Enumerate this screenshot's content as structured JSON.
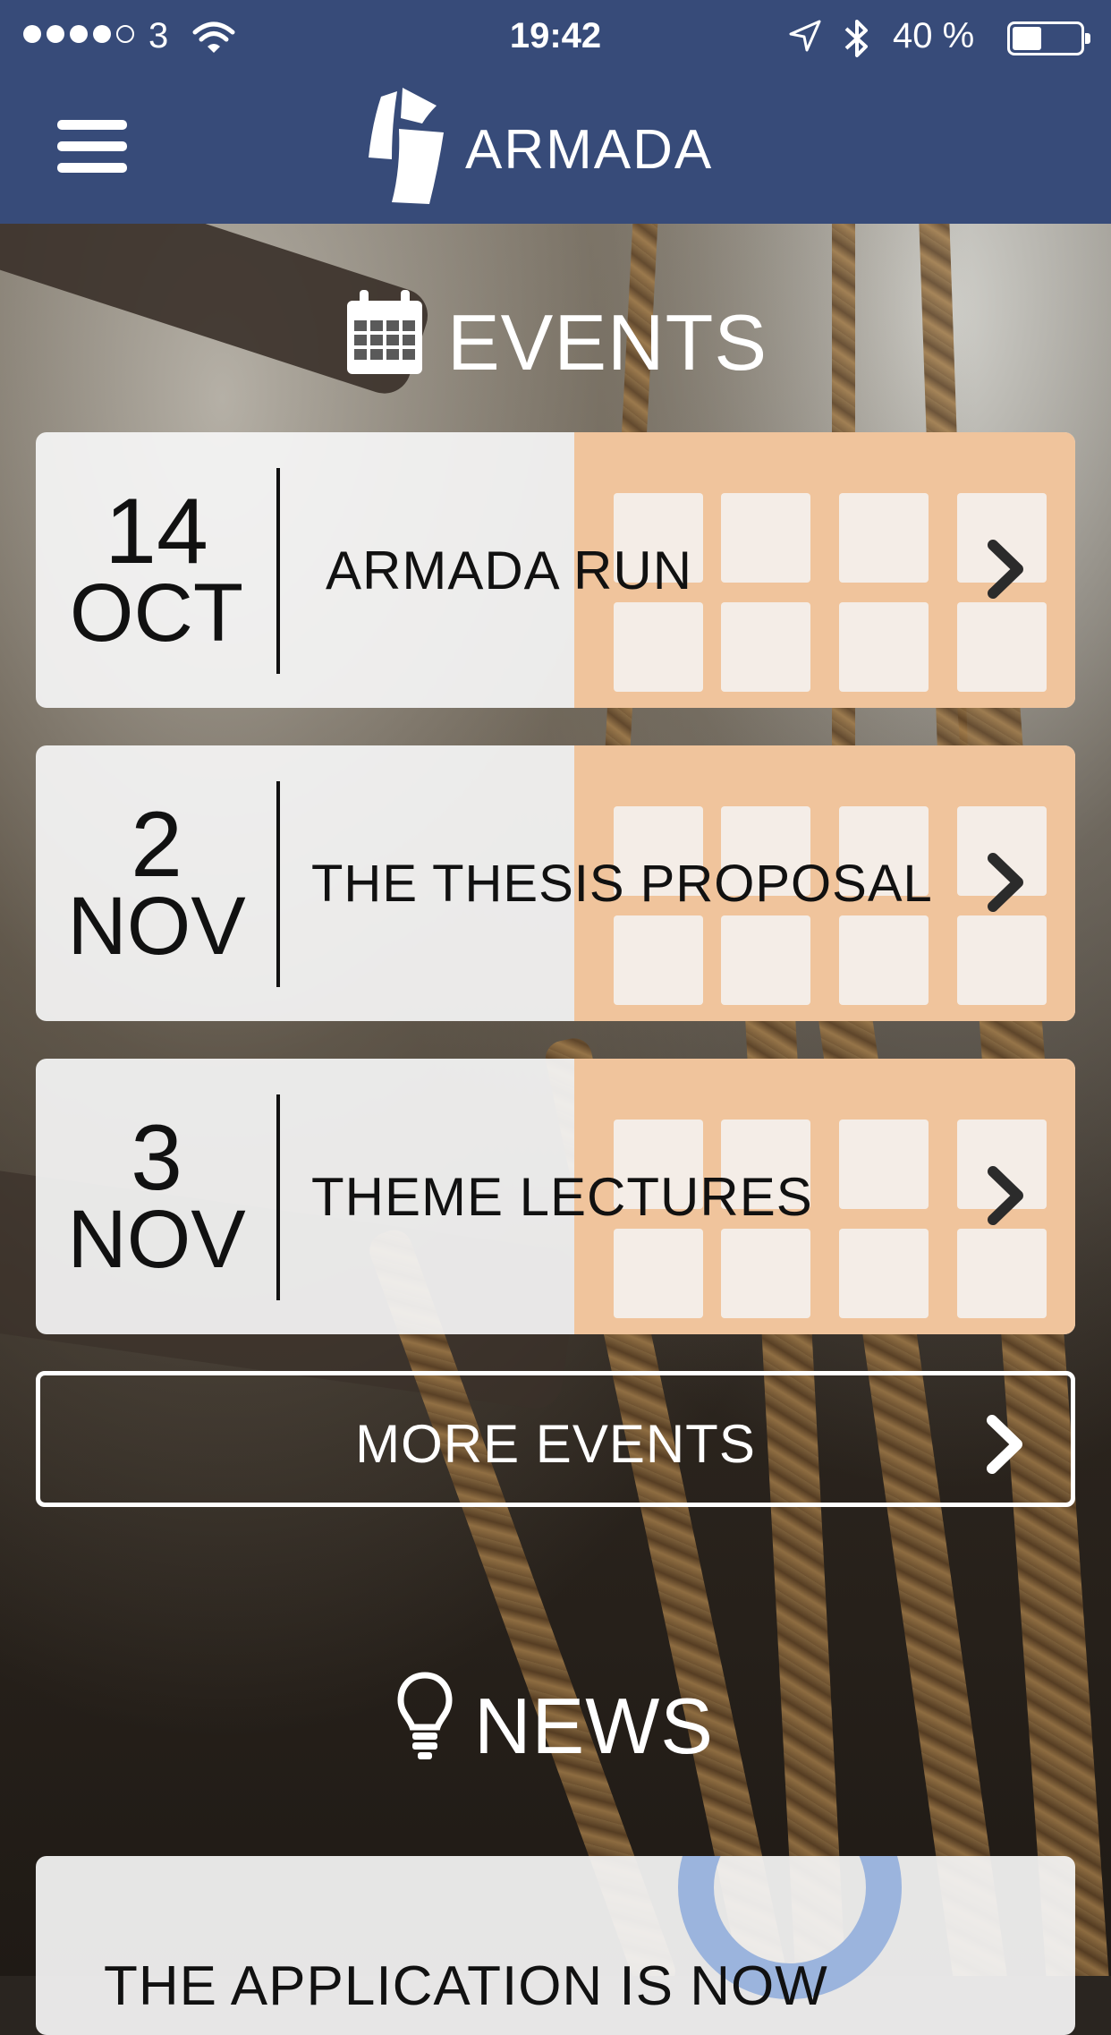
{
  "status_bar": {
    "carrier": "3",
    "time": "19:42",
    "battery": "40 %",
    "battery_level": 0.4
  },
  "header": {
    "brand": "ARMADA",
    "menu_icon": "hamburger-icon",
    "logo_icon": "ship-sail-logo"
  },
  "events": {
    "title": "EVENTS",
    "icon": "calendar-icon",
    "items": [
      {
        "day": "14",
        "month": "OCT",
        "title": "ARMADA RUN"
      },
      {
        "day": "2",
        "month": "NOV",
        "title": "THE THESIS PROPOSAL"
      },
      {
        "day": "3",
        "month": "NOV",
        "title": "THEME LECTURES"
      }
    ],
    "more_label": "MORE EVENTS"
  },
  "news": {
    "title": "NEWS",
    "icon": "lightbulb-icon",
    "items": [
      {
        "headline": "THE APPLICATION IS NOW"
      }
    ]
  },
  "colors": {
    "header_bg": "#374b79",
    "card_bg": "#f5f5f5",
    "calendar_accent": "#f0c49c",
    "news_accent": "#9bb4dd"
  }
}
